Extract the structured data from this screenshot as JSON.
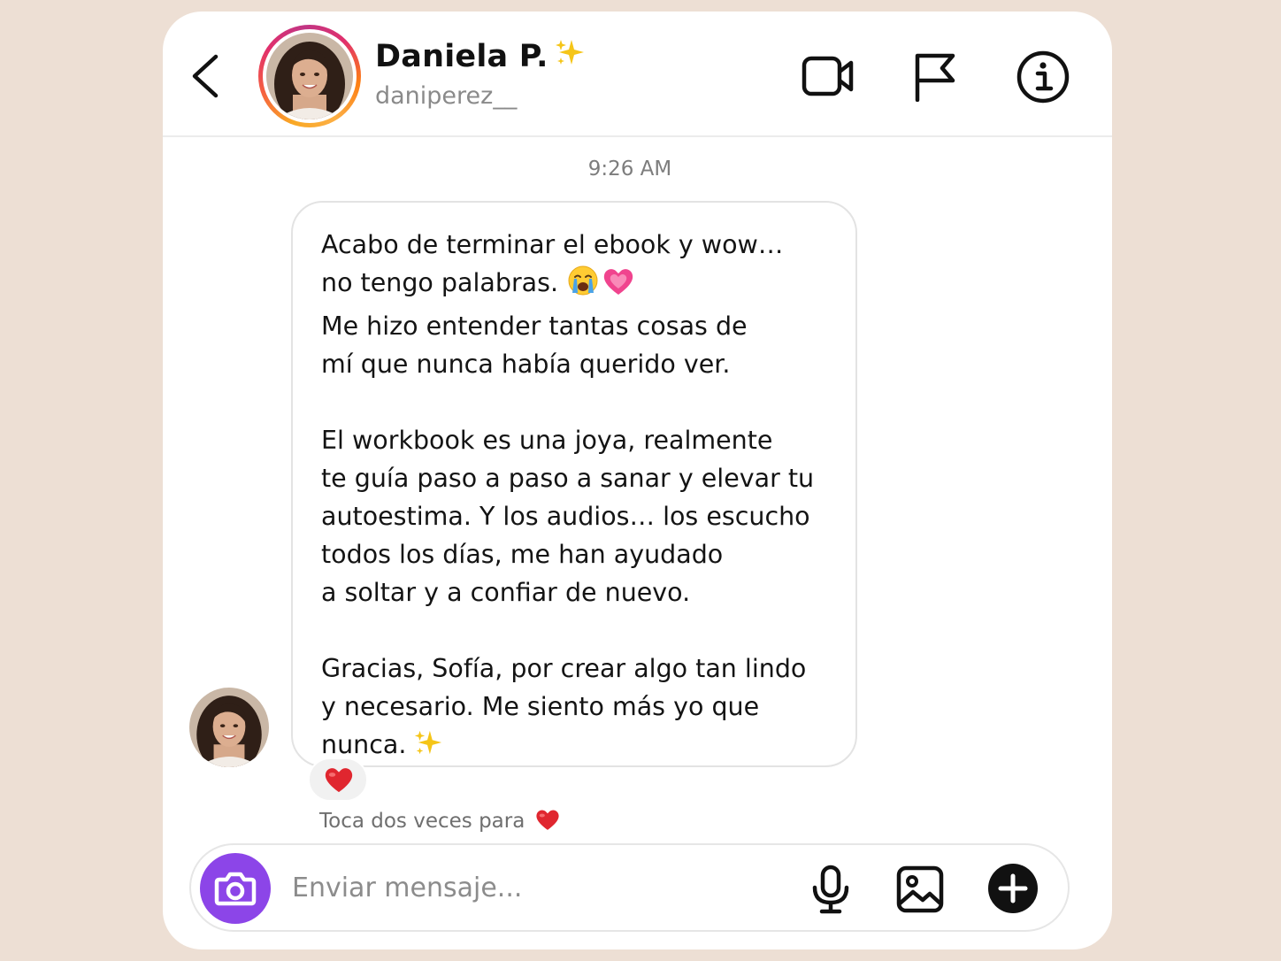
{
  "header": {
    "back_icon": "chevron-left-icon",
    "name": "Daniela P.",
    "name_badge_icon": "sparkles-icon",
    "username": "daniperez__",
    "actions": [
      {
        "name": "video-call",
        "icon": "video-camera-icon"
      },
      {
        "name": "report",
        "icon": "flag-icon"
      },
      {
        "name": "info",
        "icon": "info-circle-icon"
      }
    ]
  },
  "thread": {
    "timestamp": "9:26 AM",
    "message": {
      "lines": [
        "Acabo de terminar el ebook y wow…",
        "no tengo palabras.",
        "Me hizo entender tantas cosas de",
        "mí que nunca había querido ver.",
        "El workbook es una joya, realmente",
        "te guía paso a paso a sanar y elevar tu",
        "autoestima. Y los audios… los escucho",
        "todos los días, me han ayudado",
        "a soltar y a confiar de nuevo.",
        "Gracias, Sofía, por crear algo tan lindo",
        "y necesario. Me siento más yo que",
        "nunca."
      ],
      "emojis": [
        "crying-face",
        "growing-heart",
        "sparkles"
      ],
      "reaction": "red-heart"
    },
    "hint_text": "Toca dos veces para"
  },
  "composer": {
    "placeholder": "Enviar mensaje...",
    "camera_icon": "camera-icon",
    "actions": [
      {
        "name": "voice",
        "icon": "microphone-icon"
      },
      {
        "name": "gallery",
        "icon": "image-icon"
      },
      {
        "name": "more",
        "icon": "plus-circle-icon"
      }
    ]
  },
  "colors": {
    "background": "#eddfd4",
    "card": "#ffffff",
    "camera_button": "#8c45e8",
    "heart": "#e0262f",
    "sparkle": "#f5c518"
  }
}
